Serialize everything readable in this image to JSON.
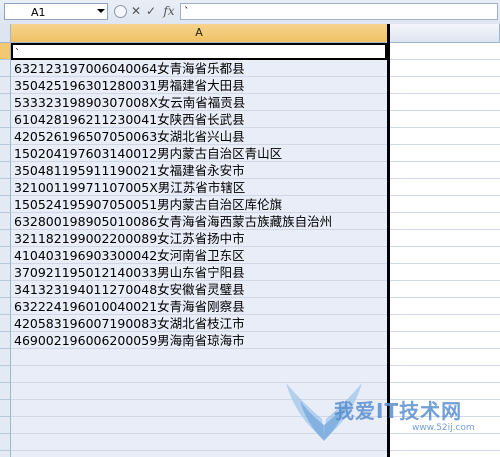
{
  "formula_bar": {
    "name_box": "A1",
    "cancel_symbol": "✕",
    "confirm_symbol": "✓",
    "fx_label": "fx",
    "formula_value": "`"
  },
  "columns": {
    "a": "A",
    "b": ""
  },
  "rows": [
    {
      "value": "`",
      "selected": true
    },
    {
      "value": "632123197006040064女青海省乐都县",
      "selected": false
    },
    {
      "value": "350425196301280031男福建省大田县",
      "selected": false
    },
    {
      "value": "53332319890307008X女云南省福贡县",
      "selected": false
    },
    {
      "value": "610428196211230041女陕西省长武县",
      "selected": false
    },
    {
      "value": "420526196507050063女湖北省兴山县",
      "selected": false
    },
    {
      "value": "150204197603140012男内蒙古自治区青山区",
      "selected": false
    },
    {
      "value": "350481195911190021女福建省永安市",
      "selected": false
    },
    {
      "value": "32100119971107005X男江苏省市辖区",
      "selected": false
    },
    {
      "value": "150524195907050051男内蒙古自治区库伦旗",
      "selected": false
    },
    {
      "value": "632800198905010086女青海省海西蒙古族藏族自治州",
      "selected": false
    },
    {
      "value": "321182199002200089女江苏省扬中市",
      "selected": false
    },
    {
      "value": "410403196903300042女河南省卫东区",
      "selected": false
    },
    {
      "value": "370921195012140033男山东省宁阳县",
      "selected": false
    },
    {
      "value": "341323194011270048女安徽省灵璧县",
      "selected": false
    },
    {
      "value": "632224196010040021女青海省刚察县",
      "selected": false
    },
    {
      "value": "420583196007190083女湖北省枝江市",
      "selected": false
    },
    {
      "value": "469002196006200059男海南省琼海市",
      "selected": false
    }
  ],
  "watermark": {
    "title": "我爱IT技术网",
    "url": "www.52ij.com"
  }
}
